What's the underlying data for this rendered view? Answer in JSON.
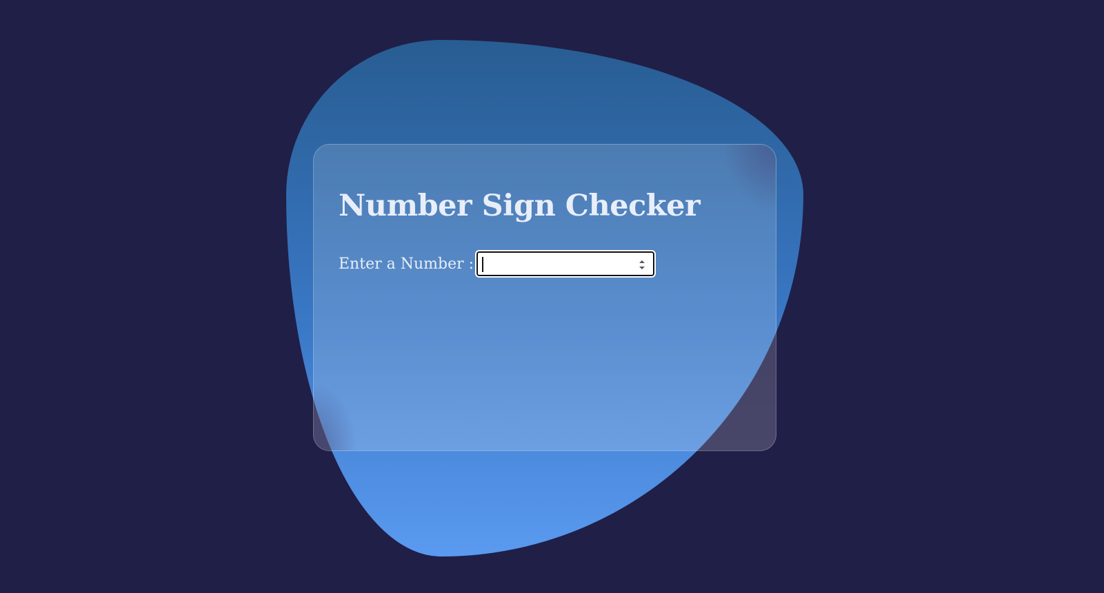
{
  "app": {
    "title": "Number Sign Checker"
  },
  "form": {
    "label": "Enter a Number :",
    "input": {
      "value": "",
      "placeholder": "",
      "type": "number"
    }
  },
  "colors": {
    "background": "#201f48",
    "blob_top": "#285d92",
    "blob_bottom": "#5a9af0",
    "text": "#e8eef9"
  },
  "icons": {
    "spinner_up": "chevron-up-icon",
    "spinner_down": "chevron-down-icon"
  }
}
